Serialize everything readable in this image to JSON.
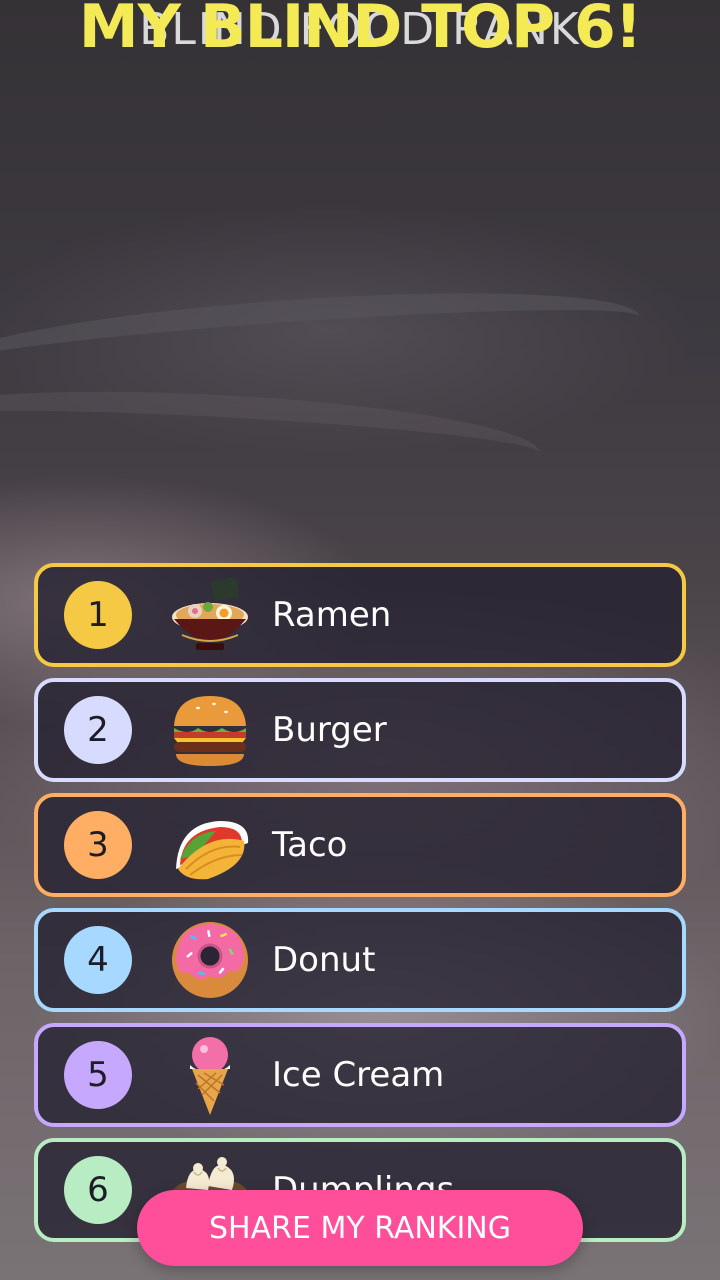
{
  "title": {
    "main": "MY BLIND TOP 6!",
    "behind": "BLIND FOOD RANK"
  },
  "rankings": [
    {
      "rank": "1",
      "name": "Ramen",
      "icon": "ramen-icon",
      "color": "#f6c945"
    },
    {
      "rank": "2",
      "name": "Burger",
      "icon": "burger-icon",
      "color": "#d7dcff"
    },
    {
      "rank": "3",
      "name": "Taco",
      "icon": "taco-icon",
      "color": "#ffae64"
    },
    {
      "rank": "4",
      "name": "Donut",
      "icon": "donut-icon",
      "color": "#a7d8ff"
    },
    {
      "rank": "5",
      "name": "Ice Cream",
      "icon": "ice-cream-icon",
      "color": "#c6a8ff"
    },
    {
      "rank": "6",
      "name": "Dumplings",
      "icon": "dumplings-icon",
      "color": "#b8ecc3"
    }
  ],
  "share_button": {
    "label": "SHARE MY RANKING",
    "color": "#ff4f9a"
  }
}
